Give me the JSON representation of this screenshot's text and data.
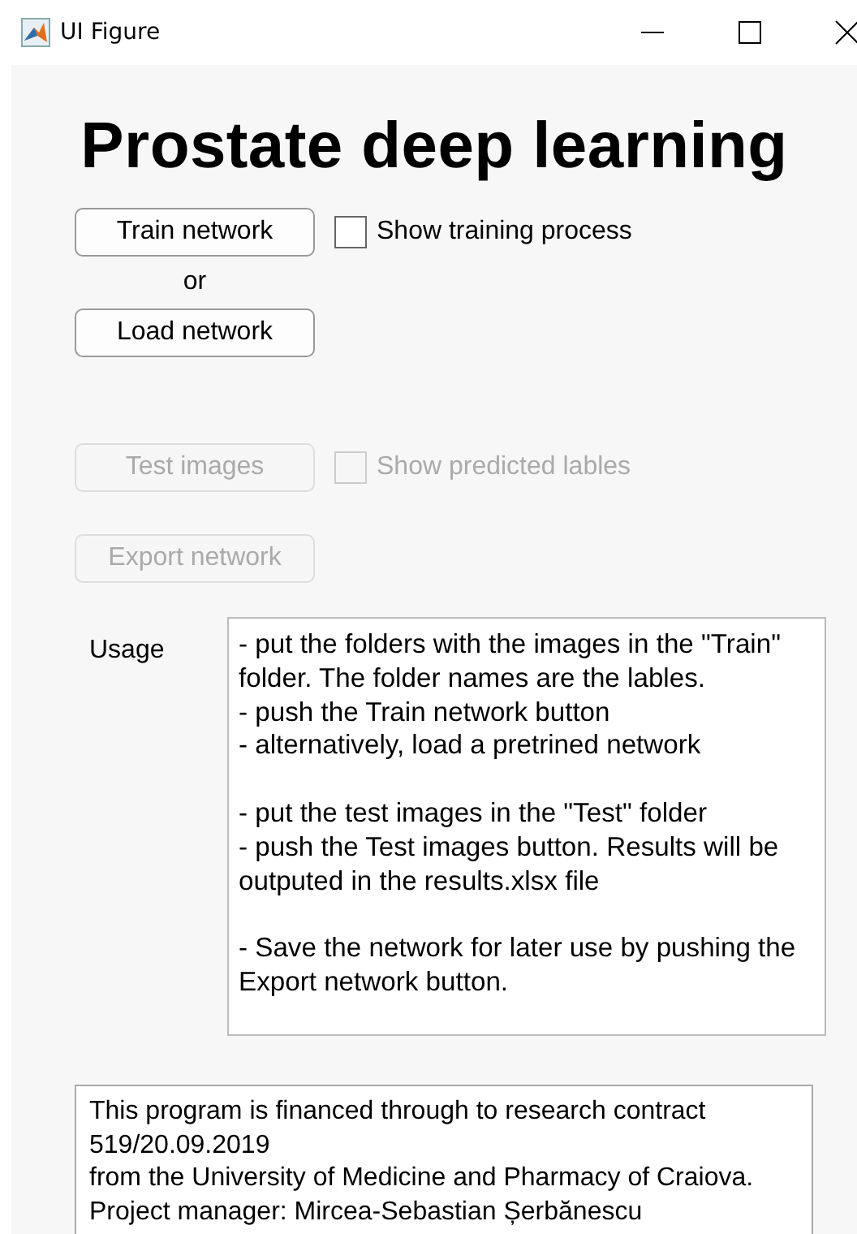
{
  "window": {
    "title": "UI Figure"
  },
  "heading": "Prostate deep learning",
  "rows": [
    {
      "button": {
        "label": "Train network",
        "disabled": false
      },
      "checkbox": {
        "label": "Show training process",
        "checked": false,
        "disabled": false
      }
    },
    {
      "separator": "or"
    },
    {
      "button": {
        "label": "Load network",
        "disabled": false
      }
    },
    {
      "button": {
        "label": "Test images",
        "disabled": true
      },
      "checkbox": {
        "label": "Show predicted lables",
        "checked": false,
        "disabled": true
      }
    },
    {
      "button": {
        "label": "Export network",
        "disabled": true
      }
    }
  ],
  "usage": {
    "label": "Usage",
    "value": "- put the folders with the images in the \"Train\" folder. The folder names are the lables.\n- push the Train network button\n- alternatively, load a pretrined network\n\n- put the test images in the \"Test\" folder\n- push the Test images button. Results will be outputed in the results.xlsx file\n\n- Save the network for later use by pushing the Export network button."
  },
  "info": {
    "lines": [
      "This program is financed through to research contract 519/20.09.2019",
      "from the University of Medicine and Pharmacy of Craiova.",
      "Project manager: Mircea-Sebastian Șerbănescu"
    ]
  }
}
